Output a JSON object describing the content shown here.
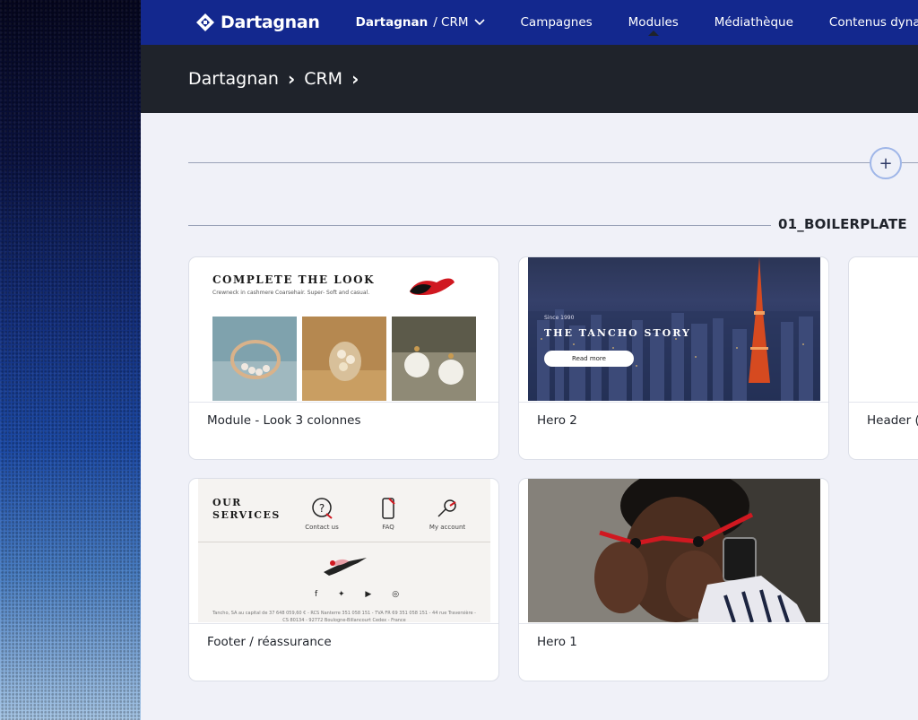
{
  "nav": {
    "brand": "Dartagnan",
    "workspace_main": "Dartagnan",
    "workspace_sub": "/ CRM",
    "items": [
      {
        "label": "Campagnes"
      },
      {
        "label": "Modules"
      },
      {
        "label": "Médiathèque"
      },
      {
        "label": "Contenus dynamiques"
      }
    ],
    "active": "Modules"
  },
  "breadcrumb": [
    "Dartagnan",
    "CRM"
  ],
  "add_button": "+",
  "section": {
    "title": "01_BOILERPLATE"
  },
  "cards": [
    {
      "label": "Module - Look 3 colonnes",
      "preview": {
        "title": "COMPLETE THE LOOK",
        "subtitle": "Crewneck in cashmere Coarsehair. Super- Soft and casual."
      }
    },
    {
      "label": "Hero 2",
      "preview": {
        "small": "Since 1990",
        "title": "THE TANCHO STORY",
        "button": "Read more"
      }
    },
    {
      "label": "Header (",
      "preview": {}
    },
    {
      "label": "Footer / réassurance",
      "preview": {
        "title": "OUR SERVICES",
        "icons": [
          "Contact us",
          "FAQ",
          "My account"
        ],
        "social": "f ✦ ▶ ◎",
        "legal": "Tancho, SA au capital de 37 648 059,60 € - RCS Nanterre 351 058 151 - TVA FR 69 351 058 151 - 44 rue Traversière - CS 80134 - 92772 Boulogne-Billancourt Cedex - France"
      }
    },
    {
      "label": "Hero 1",
      "preview": {}
    }
  ],
  "colors": {
    "navbar": "#13288e",
    "crumbbar": "#1f232b",
    "background": "#f0f1f8"
  }
}
